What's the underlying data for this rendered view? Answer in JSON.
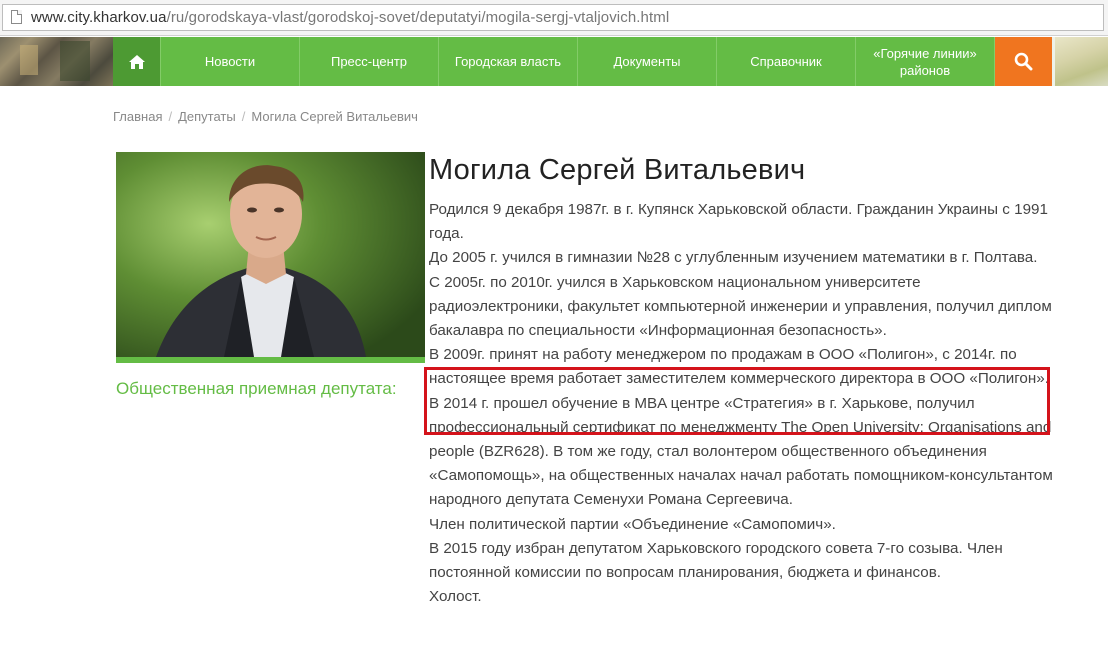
{
  "address_bar": {
    "domain": "www.city.kharkov.ua",
    "path": "/ru/gorodskaya-vlast/gorodskoj-sovet/deputatyi/mogila-sergj-vtaljovich.html"
  },
  "nav": {
    "items": [
      {
        "label": "Новости"
      },
      {
        "label": "Пресс-центр"
      },
      {
        "label": "Городская власть"
      },
      {
        "label": "Документы"
      },
      {
        "label": "Справочник"
      },
      {
        "label": "«Горячие линии» районов"
      }
    ],
    "home_icon": "home-icon",
    "search_icon": "search-icon",
    "colors": {
      "nav_green": "#64bc45",
      "home_green": "#4d9a33",
      "search_orange": "#f0751f"
    }
  },
  "breadcrumb": {
    "items": [
      "Главная",
      "Депутаты",
      "Могила Сергей Витальевич"
    ]
  },
  "profile": {
    "name": "Могила Сергей Витальевич",
    "reception_label": "Общественная приемная депутата:",
    "bio": [
      "Родился 9 декабря 1987г. в г. Купянск Харьковской области. Гражданин Украины с 1991 года.",
      "До 2005 г. учился в гимназии №28 с углубленным изучением математики в г. Полтава.",
      "С 2005г. по 2010г. учился в Харьковском национальном университете радиоэлектроники, факультет компьютерной инженерии и управления, получил диплом бакалавра по специальности «Информационная безопасность».",
      "В 2009г. принят на работу менеджером по продажам в ООО «Полигон», с 2014г. по настоящее время работает заместителем коммерческого директора в ООО «Полигон».",
      "В 2014 г. прошел обучение в MBA центре «Стратегия» в г. Харькове, получил профессиональный сертификат по менеджменту The Open University: Organisations and people (BZR628). В том же году, стал волонтером общественного объединения «Самопомощь», на общественных началах начал работать помощником-консультантом народного депутата Семенухи Романа Сергеевича.",
      "Член политической партии «Объединение «Самопомич».",
      "В 2015 году избран депутатом Харьковского городского совета 7-го созыва. Член постоянной комиссии по вопросам планирования, бюджета и финансов.",
      "Холост."
    ]
  },
  "highlight_color": "#d4131b"
}
